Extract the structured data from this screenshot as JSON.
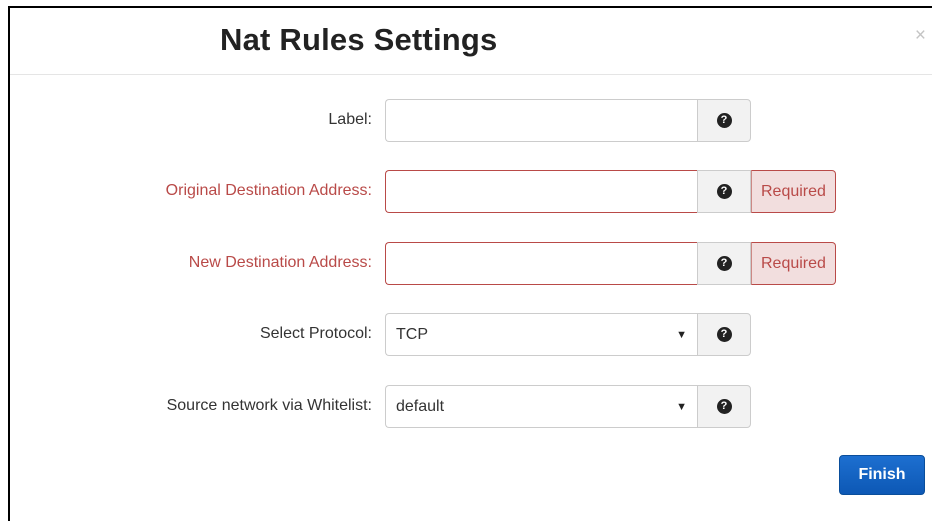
{
  "modal": {
    "title": "Nat Rules Settings",
    "close_label": "×"
  },
  "form": {
    "label_field": {
      "label": "Label:",
      "value": "",
      "help_icon": "question-circle-icon"
    },
    "original_destination": {
      "label": "Original Destination Address:",
      "value": "",
      "required": "Required",
      "help_icon": "question-circle-icon"
    },
    "new_destination": {
      "label": "New Destination Address:",
      "value": "",
      "required": "Required",
      "help_icon": "question-circle-icon"
    },
    "protocol": {
      "label": "Select Protocol:",
      "selected": "TCP",
      "help_icon": "question-circle-icon"
    },
    "source_network": {
      "label": "Source network via Whitelist:",
      "selected": "default",
      "help_icon": "question-circle-icon"
    }
  },
  "actions": {
    "finish_label": "Finish"
  },
  "colors": {
    "error": "#b94a48",
    "error_bg": "#f2dede",
    "primary": "#0d58b5"
  },
  "glyphs": {
    "help": "?",
    "dropdown_arrow": "▼"
  }
}
